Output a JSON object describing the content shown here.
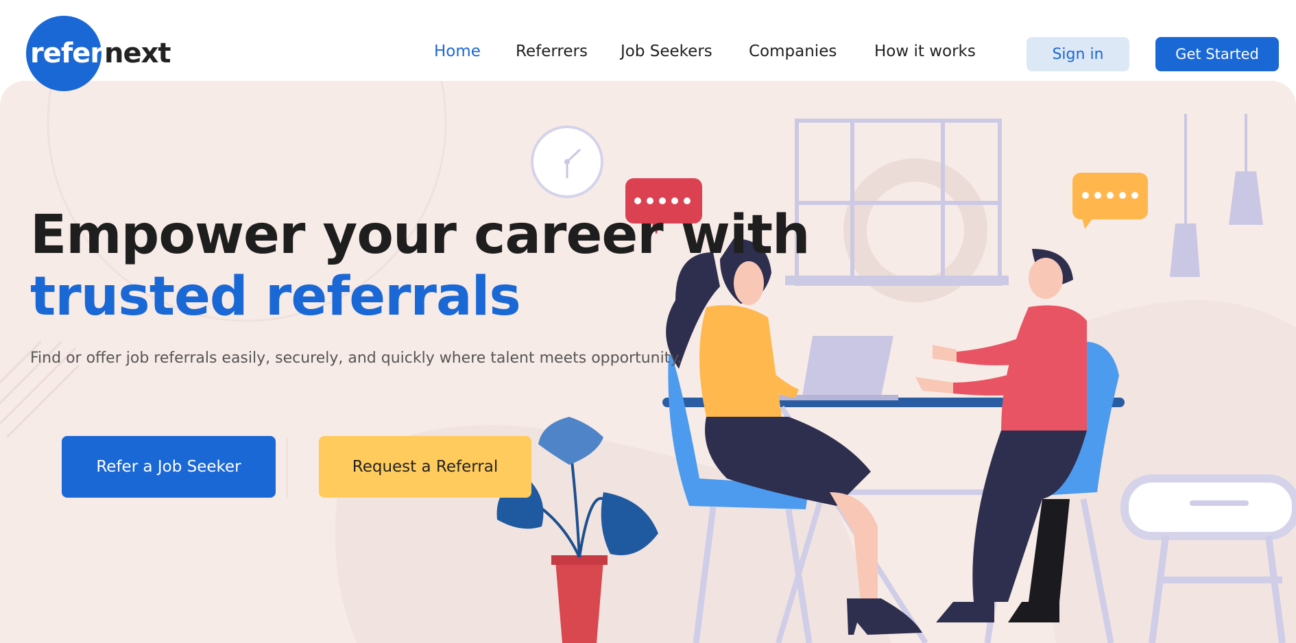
{
  "brand": {
    "logo_part1": "refer",
    "logo_part2": "next",
    "primary_color": "#1a67d6",
    "accent_color": "#ffcb5c"
  },
  "nav": {
    "items": [
      {
        "label": "Home",
        "active": true
      },
      {
        "label": "Referrers"
      },
      {
        "label": "Job Seekers"
      },
      {
        "label": "Companies"
      },
      {
        "label": "How it works"
      }
    ],
    "signin_label": "Sign in",
    "get_started_label": "Get Started"
  },
  "hero": {
    "headline_line1": "Empower your career with",
    "headline_line2": "trusted referrals",
    "subtitle": "Find or offer job referrals easily, securely, and quickly where talent meets opportunity.",
    "primary_cta": "Refer a Job Seeker",
    "secondary_cta": "Request a Referral",
    "background_color": "#f7ebe7"
  }
}
